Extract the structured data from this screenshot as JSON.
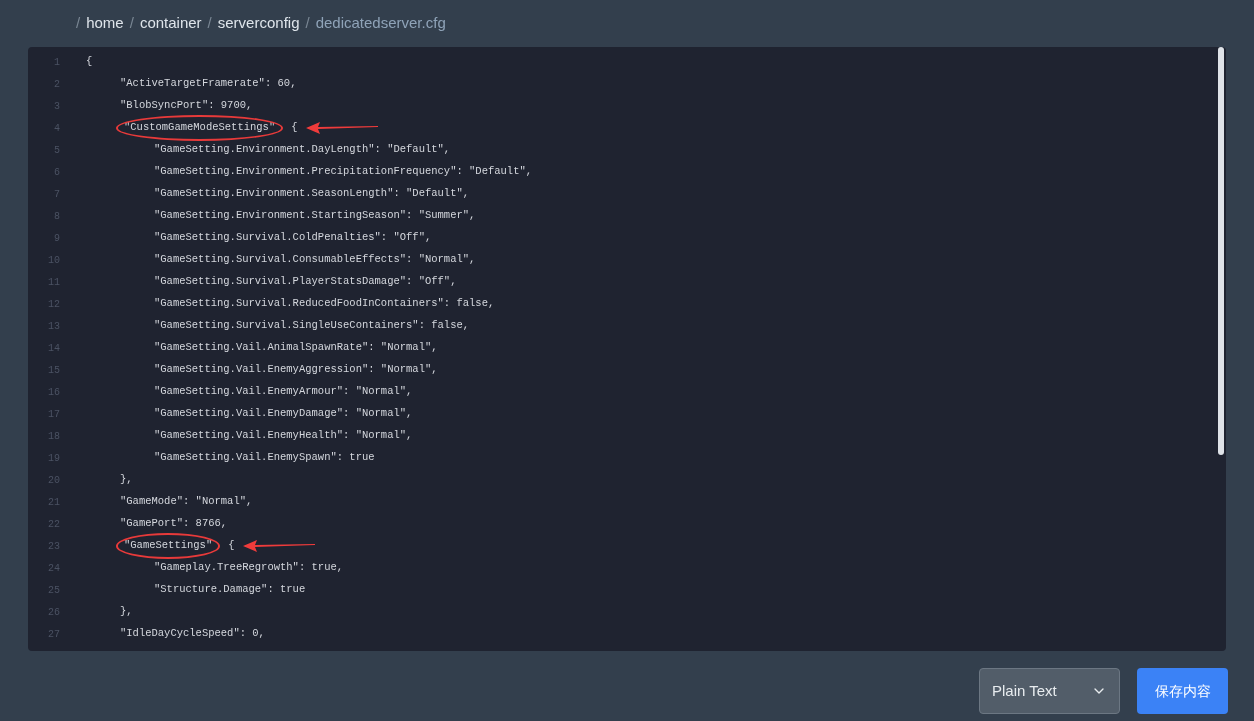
{
  "breadcrumb": [
    {
      "separator": "/",
      "label": "home",
      "current": false
    },
    {
      "separator": "/",
      "label": "container",
      "current": false
    },
    {
      "separator": "/",
      "label": "serverconfig",
      "current": false
    },
    {
      "separator": "/",
      "label": "dedicatedserver.cfg",
      "current": true
    }
  ],
  "editor": {
    "lines": [
      {
        "number": "1",
        "text": "{",
        "children": [
          {
            "number": "2",
            "text": "\"ActiveTargetFramerate\": 60,"
          },
          {
            "number": "3",
            "text": "\"BlobSyncPort\": 9700,"
          },
          {
            "number": "4",
            "text": "\"CustomGameModeSettings\"",
            "after": "{",
            "annotated": true,
            "children": [
              {
                "number": "5",
                "text": "\"GameSetting.Environment.DayLength\": \"Default\","
              },
              {
                "number": "6",
                "text": "\"GameSetting.Environment.PrecipitationFrequency\": \"Default\","
              },
              {
                "number": "7",
                "text": "\"GameSetting.Environment.SeasonLength\": \"Default\","
              },
              {
                "number": "8",
                "text": "\"GameSetting.Environment.StartingSeason\": \"Summer\","
              },
              {
                "number": "9",
                "text": "\"GameSetting.Survival.ColdPenalties\": \"Off\","
              },
              {
                "number": "10",
                "text": "\"GameSetting.Survival.ConsumableEffects\": \"Normal\","
              },
              {
                "number": "11",
                "text": "\"GameSetting.Survival.PlayerStatsDamage\": \"Off\","
              },
              {
                "number": "12",
                "text": "\"GameSetting.Survival.ReducedFoodInContainers\": false,"
              },
              {
                "number": "13",
                "text": "\"GameSetting.Survival.SingleUseContainers\": false,"
              },
              {
                "number": "14",
                "text": "\"GameSetting.Vail.AnimalSpawnRate\": \"Normal\","
              },
              {
                "number": "15",
                "text": "\"GameSetting.Vail.EnemyAggression\": \"Normal\","
              },
              {
                "number": "16",
                "text": "\"GameSetting.Vail.EnemyArmour\": \"Normal\","
              },
              {
                "number": "17",
                "text": "\"GameSetting.Vail.EnemyDamage\": \"Normal\","
              },
              {
                "number": "18",
                "text": "\"GameSetting.Vail.EnemyHealth\": \"Normal\","
              },
              {
                "number": "19",
                "text": "\"GameSetting.Vail.EnemySpawn\": true"
              }
            ]
          },
          {
            "number": "20",
            "text": "},"
          },
          {
            "number": "21",
            "text": "\"GameMode\": \"Normal\","
          },
          {
            "number": "22",
            "text": "\"GamePort\": 8766,"
          },
          {
            "number": "23",
            "text": "\"GameSettings\"",
            "after": "{",
            "annotated": true,
            "children": [
              {
                "number": "24",
                "text": "\"Gameplay.TreeRegrowth\": true,"
              },
              {
                "number": "25",
                "text": "\"Structure.Damage\": true"
              }
            ]
          },
          {
            "number": "26",
            "text": "},"
          },
          {
            "number": "27",
            "text": "\"IdleDayCycleSpeed\": 0,"
          }
        ]
      }
    ]
  },
  "language_select": {
    "value": "Plain Text"
  },
  "save_button": {
    "label": "保存内容"
  }
}
